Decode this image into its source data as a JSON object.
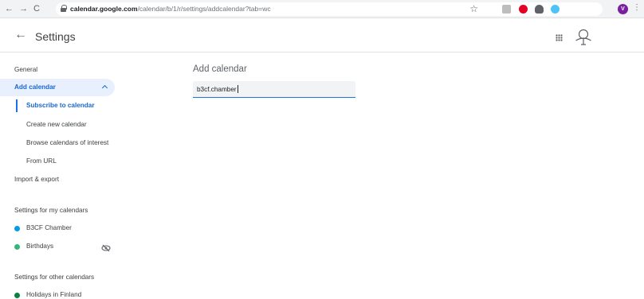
{
  "browser": {
    "url_domain": "calendar.google.com",
    "url_path": "/calendar/b/1/r/settings/addcalendar?tab=wc",
    "avatar_letter": "V",
    "back_label": "←",
    "forward_label": "→",
    "reload_label": "C",
    "star_label": "☆",
    "menu_label": "⋮"
  },
  "header": {
    "back_label": "←",
    "title": "Settings"
  },
  "sidebar": {
    "general": "General",
    "add_calendar": "Add calendar",
    "sub_items": [
      "Subscribe to calendar",
      "Create new calendar",
      "Browse calendars of interest",
      "From URL"
    ],
    "import_export": "Import & export",
    "my_calendars_heading": "Settings for my calendars",
    "my_calendars": [
      {
        "name": "B3CF Chamber",
        "color": "#039be5"
      },
      {
        "name": "Birthdays",
        "color": "#33b679"
      }
    ],
    "other_calendars_heading": "Settings for other calendars",
    "other_calendars": [
      {
        "name": "Holidays in Finland",
        "color": "#0b8043"
      }
    ]
  },
  "main": {
    "title": "Add calendar",
    "input_value": "b3cf.chamber"
  },
  "colors": {
    "accent": "#1a73e8",
    "active_text": "#1967d2",
    "active_bg": "#e8f0fe"
  }
}
